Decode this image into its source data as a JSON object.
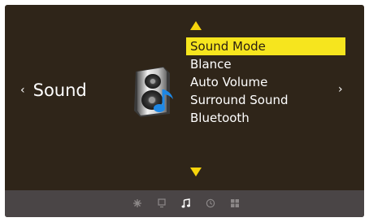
{
  "header": {
    "back_arrow": "‹",
    "title": "Sound",
    "next_arrow": "›"
  },
  "category_icon": "speaker-music-icon",
  "menu": {
    "items": [
      {
        "label": "Sound Mode",
        "selected": true
      },
      {
        "label": "Blance",
        "selected": false
      },
      {
        "label": "Auto Volume",
        "selected": false
      },
      {
        "label": "Surround Sound",
        "selected": false
      },
      {
        "label": "Bluetooth",
        "selected": false
      }
    ]
  },
  "bottom_bar": {
    "icons": [
      {
        "name": "picture-settings-icon",
        "active": false
      },
      {
        "name": "display-icon",
        "active": false
      },
      {
        "name": "music-note-icon",
        "active": true
      },
      {
        "name": "clock-icon",
        "active": false
      },
      {
        "name": "grid-icon",
        "active": false
      }
    ]
  },
  "colors": {
    "background": "#2f2519",
    "highlight": "#f6e51e",
    "arrow": "#f6d40b",
    "bar": "#4a4546",
    "icon_inactive": "#8c8888",
    "icon_active": "#ffffff"
  }
}
